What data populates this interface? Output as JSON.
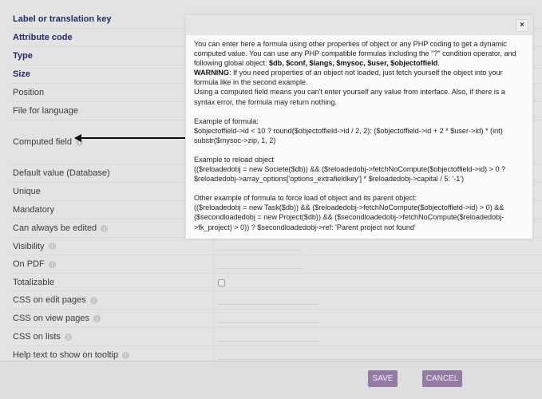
{
  "form": {
    "rows": [
      {
        "label": "Label or translation key",
        "required": true,
        "info": false,
        "field": "none"
      },
      {
        "label": "Attribute code",
        "required": true,
        "info": false,
        "field": "none"
      },
      {
        "label": "Type",
        "required": true,
        "info": false,
        "field": "none"
      },
      {
        "label": "Size",
        "required": true,
        "info": false,
        "field": "none"
      },
      {
        "label": "Position",
        "required": false,
        "info": false,
        "field": "none"
      },
      {
        "label": "File for language",
        "required": false,
        "info": false,
        "field": "none"
      },
      {
        "label": "Computed field",
        "required": false,
        "info": true,
        "field": "none"
      },
      {
        "label": "Default value (Database)",
        "required": false,
        "info": false,
        "field": "none"
      },
      {
        "label": "Unique",
        "required": false,
        "info": false,
        "field": "none"
      },
      {
        "label": "Mandatory",
        "required": false,
        "info": false,
        "field": "none"
      },
      {
        "label": "Can always be edited",
        "required": false,
        "info": true,
        "field": "none"
      },
      {
        "label": "Visibility",
        "required": false,
        "info": true,
        "field": "text-short"
      },
      {
        "label": "On PDF",
        "required": false,
        "info": true,
        "field": "text-short"
      },
      {
        "label": "Totalizable",
        "required": false,
        "info": false,
        "field": "checkbox",
        "checked": false
      },
      {
        "label": "CSS on edit pages",
        "required": false,
        "info": true,
        "field": "text"
      },
      {
        "label": "CSS on view pages",
        "required": false,
        "info": true,
        "field": "text"
      },
      {
        "label": "CSS on lists",
        "required": false,
        "info": true,
        "field": "text"
      },
      {
        "label": "Help text to show on tooltip",
        "required": false,
        "info": true,
        "field": "text-long"
      }
    ]
  },
  "buttons": {
    "save": "SAVE",
    "cancel": "CANCEL"
  },
  "tooltip_dialog": {
    "close_icon": "×",
    "intro_1": "You can enter here a formula using other properties of object or any PHP coding to get a dynamic computed value. You can use any PHP compatible formulas including the \"?\" condition operator, and following global object: ",
    "intro_globals": "$db, $conf, $langs, $mysoc, $user, $objectoffield",
    "intro_end": ".",
    "warning_label": "WARNING",
    "warning_text": ": If you need properties of an object not loaded, just fetch yourself the object into your formula like in the second example.",
    "computed_note": "Using a computed field means you can't enter yourself any value from interface. Also, if there is a syntax error, the formula may return nothing.",
    "example1_title": "Example of formula:",
    "example1_code": "$objectoffield->id < 10 ? round($objectoffield->id / 2, 2): ($objectoffield->id + 2 * $user->id) * (int) substr($mysoc->zip, 1, 2)",
    "example2_title": "Example to reload object",
    "example2_code": "(($reloadedobj = new Societe($db)) && ($reloadedobj->fetchNoCompute($objectoffield->id) > 0 ? $reloadedobj->array_options['options_extrafieldkey'] * $reloadedobj->capital / 5: '-1')",
    "example3_title": "Other example of formula to force load of object and its parent object:",
    "example3_code": "(($reloadedobj = new Task($db)) && ($reloadedobj->fetchNoCompute($objectoffield->id) > 0) && ($secondloadedobj = new Project($db)) && ($secondloadedobj->fetchNoCompute($reloadedobj->fk_project) > 0)) ? $secondloadedobj->ref: 'Parent project not found'"
  },
  "colors": {
    "required_label": "#252b63",
    "button_bg": "#947ba4"
  }
}
